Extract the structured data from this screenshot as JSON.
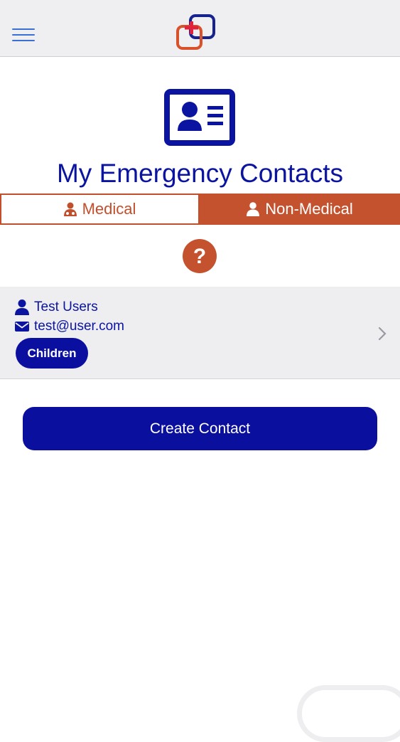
{
  "header": {
    "menu_icon": "hamburger-menu-icon",
    "logo_icon": "medical-cross-logo-icon"
  },
  "page": {
    "header_icon": "id-card-icon",
    "title": "My Emergency Contacts"
  },
  "tabs": [
    {
      "label": "Medical",
      "icon": "doctor-icon",
      "selected": false
    },
    {
      "label": "Non-Medical",
      "icon": "user-icon",
      "selected": true
    }
  ],
  "help": {
    "icon": "question-circle-icon"
  },
  "contacts": [
    {
      "name": "Test Users",
      "email": "test@user.com",
      "tag": "Children",
      "name_icon": "user-icon",
      "email_icon": "envelope-icon",
      "chevron_icon": "chevron-right-icon"
    }
  ],
  "actions": {
    "create_label": "Create Contact"
  },
  "colors": {
    "primary": "#0a14a0",
    "accent": "#c4522e",
    "header_bg": "#efeff1",
    "row_bg": "#eeeef1",
    "menu_blue": "#3a6fd6"
  }
}
